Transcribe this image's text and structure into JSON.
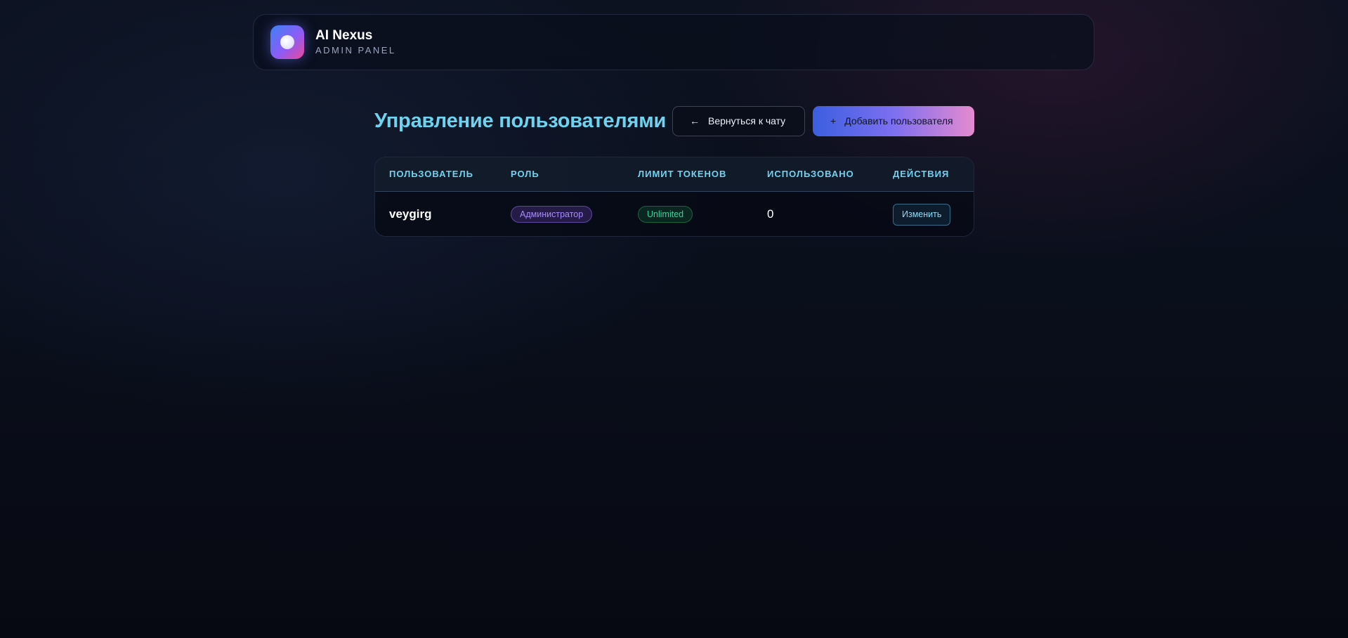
{
  "app": {
    "name": "AI Nexus",
    "subtitle": "ADMIN PANEL"
  },
  "icons": {
    "logo": "app-logo-icon",
    "back": "arrow-left-icon",
    "add": "plus-icon"
  },
  "colors": {
    "accent": "#6fd3f0",
    "gradient_start": "#3b5fe0",
    "gradient_end": "#e58ad0",
    "role_badge": "#a78bfa",
    "limit_badge": "#34d399"
  },
  "page": {
    "title": "Управление пользователями",
    "back_button": "Вернуться к чату",
    "back_icon_glyph": "←",
    "add_button": "Добавить пользователя",
    "add_icon_glyph": "+"
  },
  "table": {
    "columns": [
      "Пользователь",
      "Роль",
      "Лимит токенов",
      "Использовано",
      "Действия"
    ],
    "rows": [
      {
        "username": "veygirg",
        "role": "Администратор",
        "token_limit": "Unlimited",
        "used": "0",
        "action": "Изменить"
      }
    ]
  }
}
